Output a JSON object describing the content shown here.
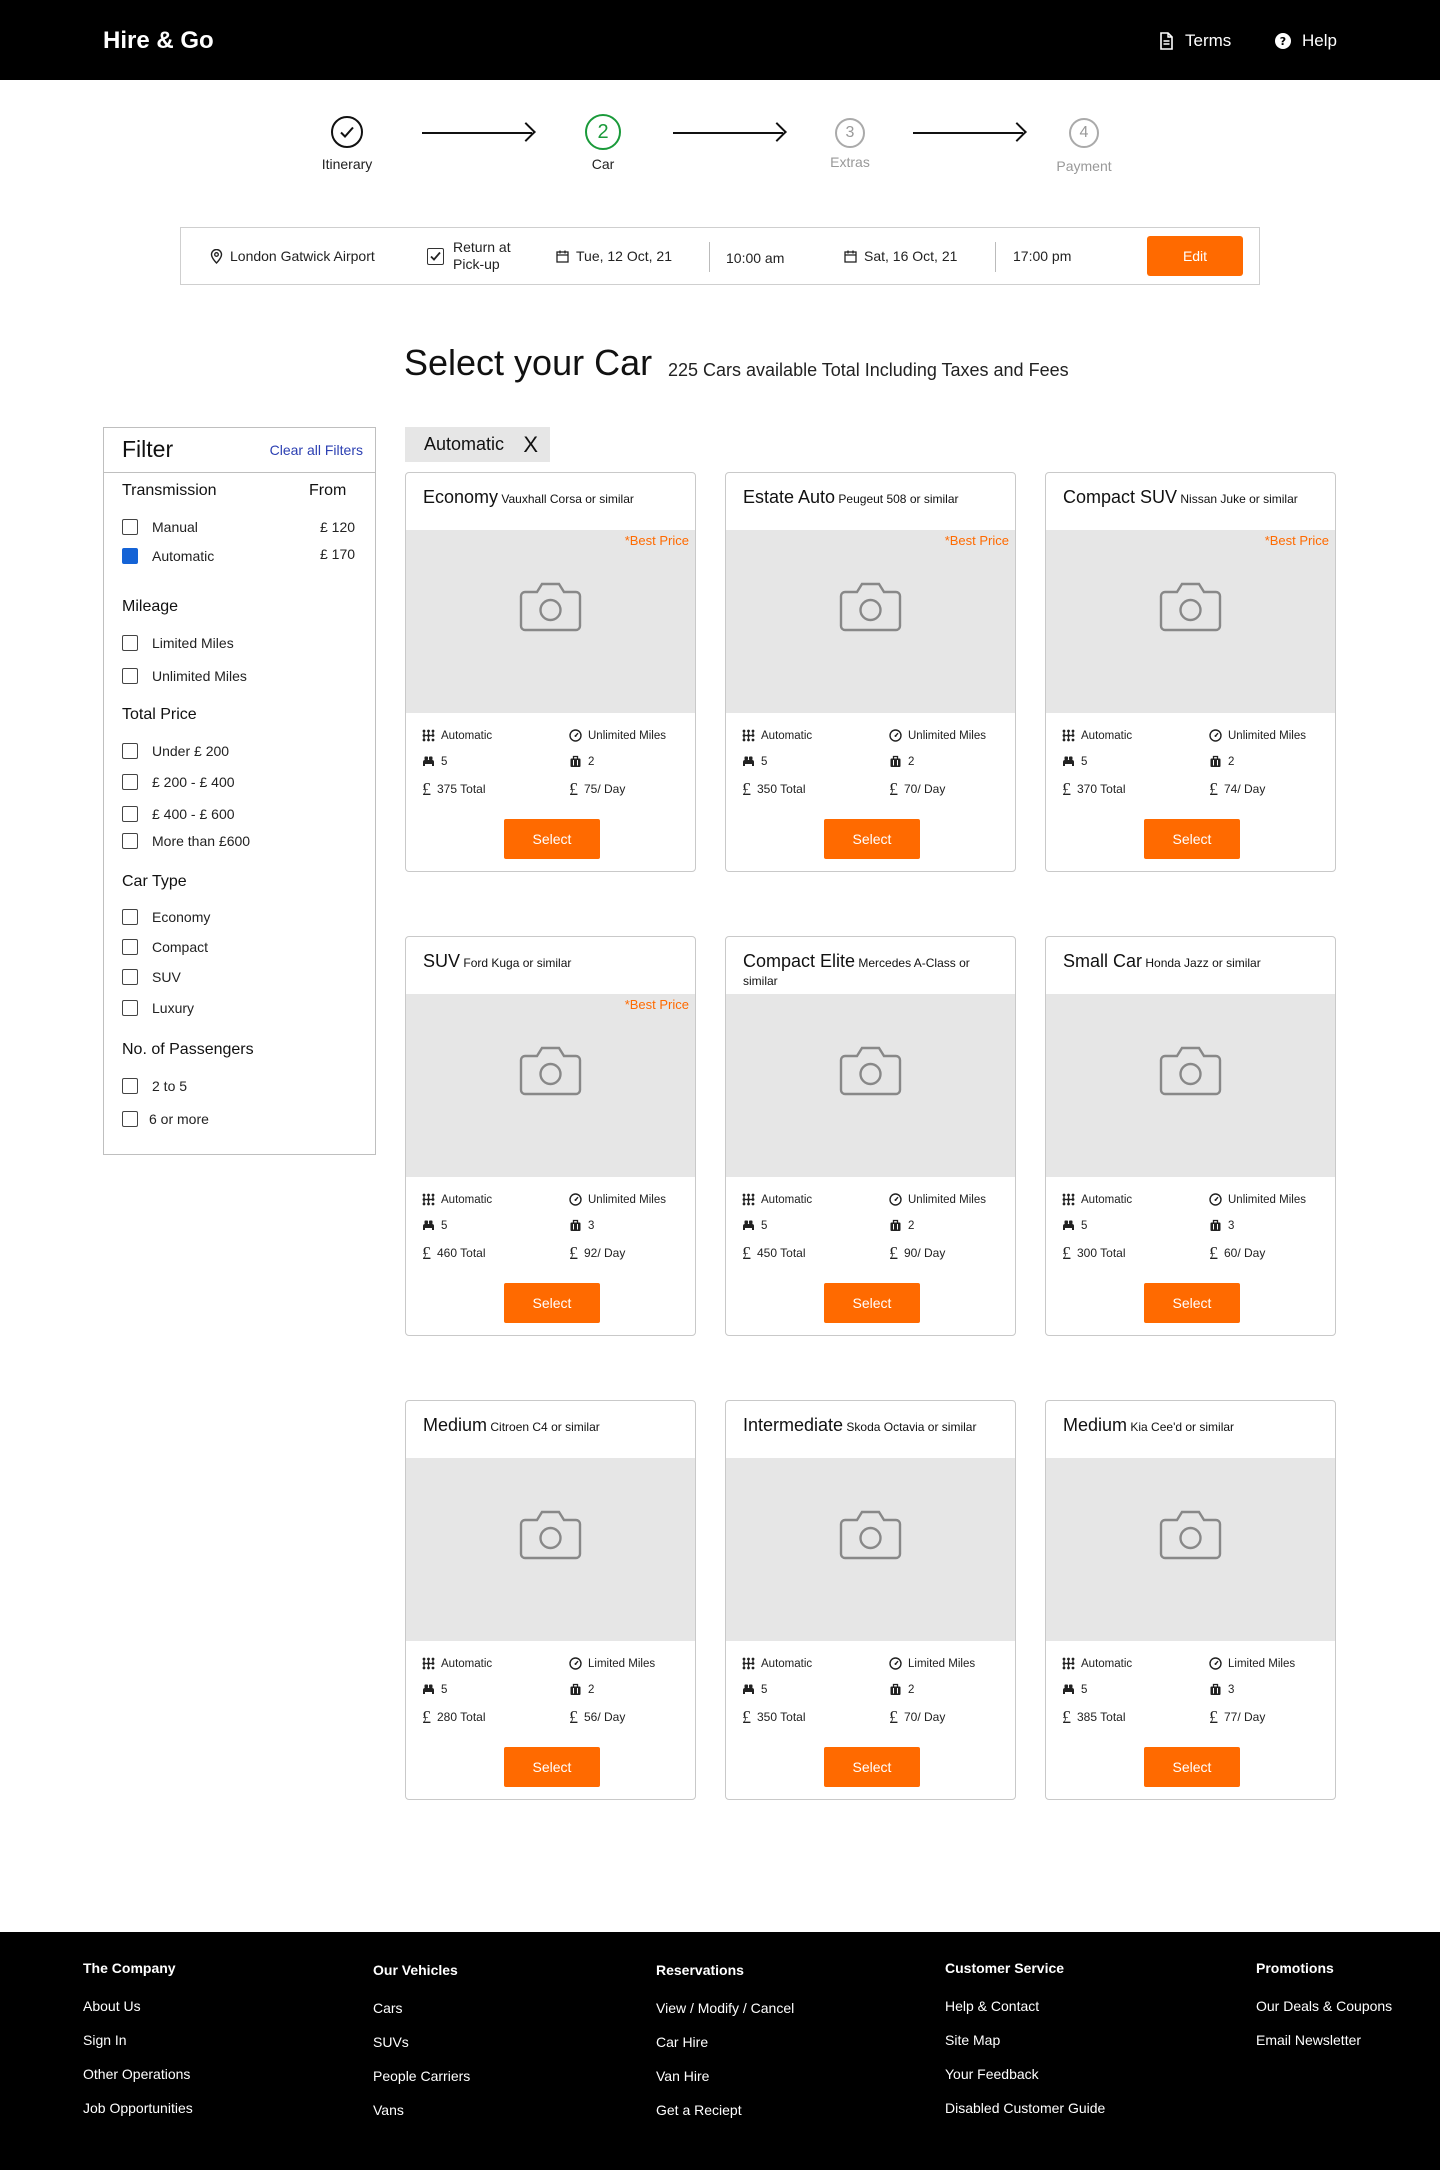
{
  "header": {
    "logo": "Hire & Go",
    "terms": "Terms",
    "help": "Help"
  },
  "stepper": {
    "steps": [
      {
        "label": "Itinerary",
        "number": "",
        "state": "done"
      },
      {
        "label": "Car",
        "number": "2",
        "state": "active"
      },
      {
        "label": "Extras",
        "number": "3",
        "state": "upcoming"
      },
      {
        "label": "Payment",
        "number": "4",
        "state": "upcoming"
      }
    ]
  },
  "search": {
    "location": "London Gatwick Airport",
    "return_line1": "Return at",
    "return_line2": "Pick-up",
    "pickup_date": "Tue, 12 Oct, 21",
    "pickup_time": "10:00 am",
    "dropoff_date": "Sat, 16 Oct, 21",
    "dropoff_time": "17:00 pm",
    "edit": "Edit"
  },
  "main": {
    "title": "Select your Car",
    "subtitle": "225 Cars available Total Including Taxes and Fees",
    "active_chip": "Automatic",
    "chip_close": "X"
  },
  "filter": {
    "title": "Filter",
    "clear": "Clear all Filters",
    "transmission": {
      "heading": "Transmission",
      "from": "From",
      "options": [
        {
          "label": "Manual",
          "price": "£ 120",
          "checked": false
        },
        {
          "label": "Automatic",
          "price": "£ 170",
          "checked": true
        }
      ]
    },
    "mileage": {
      "heading": "Mileage",
      "options": [
        "Limited Miles",
        "Unlimited Miles"
      ]
    },
    "total_price": {
      "heading": "Total Price",
      "options": [
        "Under £ 200",
        "£ 200  - £ 400",
        "£ 400  - £ 600",
        "More than £600"
      ]
    },
    "car_type": {
      "heading": "Car Type",
      "options": [
        "Economy",
        "Compact",
        "SUV",
        "Luxury"
      ]
    },
    "passengers": {
      "heading": "No. of Passengers",
      "options": [
        "2 to 5",
        "6 or more"
      ]
    }
  },
  "cars": [
    {
      "name": "Economy",
      "model": "Vauxhall Corsa or similar",
      "best": "*Best Price",
      "transmission": "Automatic",
      "mileage": "Unlimited Miles",
      "seats": "5",
      "bags": "2",
      "total": "375 Total",
      "per_day": "75/ Day",
      "select": "Select"
    },
    {
      "name": "Estate Auto",
      "model": "Peugeut 508 or similar",
      "best": "*Best Price",
      "transmission": "Automatic",
      "mileage": "Unlimited Miles",
      "seats": "5",
      "bags": "2",
      "total": "350 Total",
      "per_day": "70/ Day",
      "select": "Select"
    },
    {
      "name": "Compact SUV",
      "model": "Nissan Juke or similar",
      "best": "*Best Price",
      "transmission": "Automatic",
      "mileage": "Unlimited Miles",
      "seats": "5",
      "bags": "2",
      "total": "370 Total",
      "per_day": "74/ Day",
      "select": "Select"
    },
    {
      "name": "SUV",
      "model": "Ford Kuga or similar",
      "best": "*Best Price",
      "transmission": "Automatic",
      "mileage": "Unlimited Miles",
      "seats": "5",
      "bags": "3",
      "total": "460 Total",
      "per_day": "92/ Day",
      "select": "Select"
    },
    {
      "name": "Compact Elite",
      "model": "Mercedes A-Class or similar",
      "best": "",
      "transmission": "Automatic",
      "mileage": "Unlimited Miles",
      "seats": "5",
      "bags": "2",
      "total": "450 Total",
      "per_day": "90/ Day",
      "select": "Select"
    },
    {
      "name": "Small Car",
      "model": "Honda Jazz or similar",
      "best": "",
      "transmission": "Automatic",
      "mileage": "Unlimited Miles",
      "seats": "5",
      "bags": "3",
      "total": "300 Total",
      "per_day": "60/ Day",
      "select": "Select"
    },
    {
      "name": "Medium",
      "model": "Citroen C4 or similar",
      "best": "",
      "transmission": "Automatic",
      "mileage": "Limited Miles",
      "seats": "5",
      "bags": "2",
      "total": "280 Total",
      "per_day": "56/ Day",
      "select": "Select"
    },
    {
      "name": "Intermediate",
      "model": "Skoda Octavia or similar",
      "best": "",
      "transmission": "Automatic",
      "mileage": "Limited Miles",
      "seats": "5",
      "bags": "2",
      "total": "350 Total",
      "per_day": "70/ Day",
      "select": "Select"
    },
    {
      "name": "Medium",
      "model": "Kia Cee'd or similar",
      "best": "",
      "transmission": "Automatic",
      "mileage": "Limited Miles",
      "seats": "5",
      "bags": "3",
      "total": "385 Total",
      "per_day": "77/ Day",
      "select": "Select"
    }
  ],
  "footer": {
    "columns": [
      {
        "heading": "The Company",
        "links": [
          "About Us",
          "Sign In",
          "Other Operations",
          "Job Opportunities"
        ]
      },
      {
        "heading": "Our Vehicles",
        "links": [
          "Cars",
          "SUVs",
          "People Carriers",
          "Vans"
        ]
      },
      {
        "heading": "Reservations",
        "links": [
          "View / Modify / Cancel",
          "Car Hire",
          "Van Hire",
          "Get a Reciept"
        ]
      },
      {
        "heading": "Customer Service",
        "links": [
          "Help & Contact",
          "Site Map",
          "Your Feedback",
          "Disabled Customer Guide"
        ]
      },
      {
        "heading": "Promotions",
        "links": [
          "Our Deals & Coupons",
          "Email Newsletter"
        ]
      }
    ]
  },
  "colors": {
    "accent": "#ff6a00",
    "active_step": "#1a9a3a",
    "checkbox_checked": "#1463d6",
    "link": "#2b3fb2"
  },
  "icons": {
    "terms": "document-icon",
    "help": "question-circle-icon",
    "location": "map-pin-icon",
    "calendar": "calendar-icon",
    "photo_placeholder": "camera-icon",
    "transmission": "gear-grid-icon",
    "mileage": "speedometer-icon",
    "seats": "car-seat-icon",
    "bags": "luggage-icon",
    "price": "pound-icon"
  }
}
